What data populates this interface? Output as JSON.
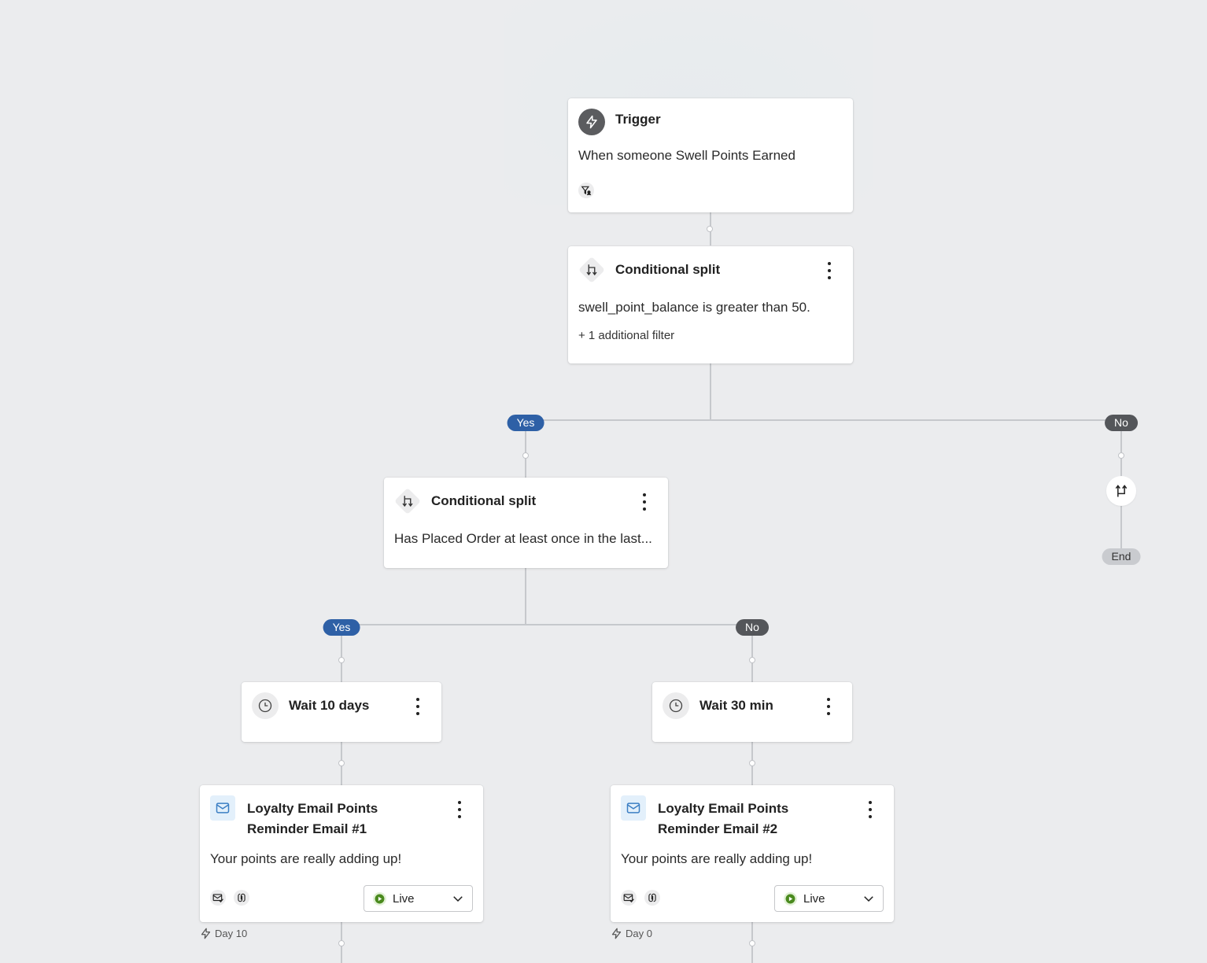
{
  "trigger": {
    "title": "Trigger",
    "description": "When someone Swell Points Earned",
    "icon": "lightning-icon",
    "filter_icon": "filter-profile-icon"
  },
  "split1": {
    "title": "Conditional split",
    "condition": "swell_point_balance is greater than 50.",
    "extra": "+ 1 additional filter",
    "icon": "split-icon",
    "yes_label": "Yes",
    "no_label": "No"
  },
  "no_branch": {
    "end_label": "End",
    "icon": "split-merge-icon"
  },
  "split2": {
    "title": "Conditional split",
    "condition": "Has Placed Order at least once in the last...",
    "icon": "split-icon",
    "yes_label": "Yes",
    "no_label": "No"
  },
  "wait1": {
    "title": "Wait 10 days",
    "icon": "clock-icon"
  },
  "wait2": {
    "title": "Wait 30 min",
    "icon": "clock-icon"
  },
  "email1": {
    "title_line1": "Loyalty Email Points",
    "title_line2": "Reminder Email #1",
    "subject": "Your points are really adding up!",
    "status": "Live",
    "day": "Day 10",
    "icon": "email-icon"
  },
  "email2": {
    "title_line1": "Loyalty Email Points",
    "title_line2": "Reminder Email #2",
    "subject": "Your points are really adding up!",
    "status": "Live",
    "day": "Day 0",
    "icon": "email-icon"
  },
  "colors": {
    "background": "#ebecee",
    "yes_pill": "#2e60a6",
    "no_pill": "#54565a",
    "live_green": "#4a8a1e",
    "email_blue": "#3c7fc4"
  }
}
